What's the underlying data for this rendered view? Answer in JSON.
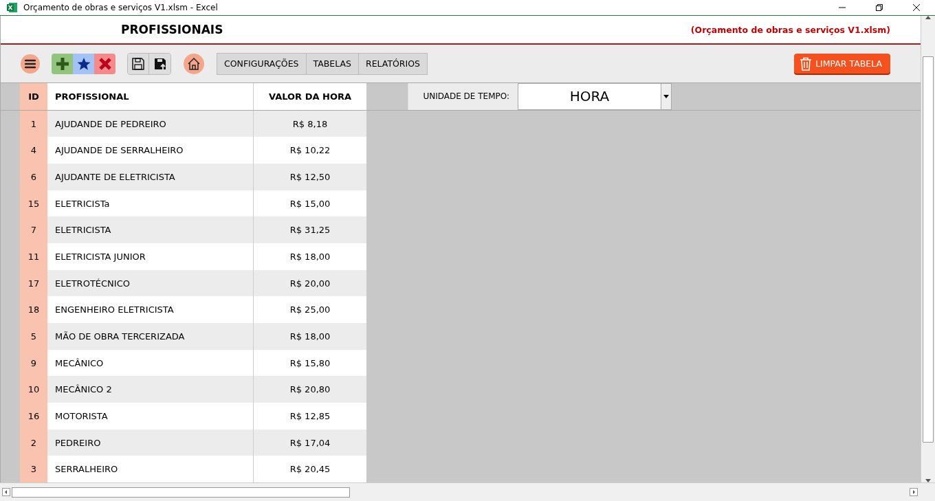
{
  "window": {
    "title": "Orçamento de obras e serviços V1.xlsm - Excel"
  },
  "header": {
    "title": "PROFISSIONAIS",
    "file": "(Orçamento de obras e serviços V1.xlsm)"
  },
  "menus": [
    {
      "label": "CONFIGURAÇÕES"
    },
    {
      "label": "TABELAS"
    },
    {
      "label": "RELATÓRIOS"
    }
  ],
  "clear_button": {
    "label": "LIMPAR TABELA"
  },
  "table": {
    "columns": [
      "ID",
      "PROFISSIONAL",
      "VALOR DA HORA"
    ],
    "rows": [
      [
        "1",
        "AJUDANDE DE PEDREIRO",
        "R$ 8,18"
      ],
      [
        "4",
        "AJUDANDE DE SERRALHEIRO",
        "R$ 10,22"
      ],
      [
        "6",
        "AJUDANTE DE ELETRICISTA",
        "R$ 12,50"
      ],
      [
        "15",
        "ELETRICISTa",
        "R$ 15,00"
      ],
      [
        "7",
        "ELETRICISTA",
        "R$ 31,25"
      ],
      [
        "11",
        "ELETRICISTA JUNIOR",
        "R$ 18,00"
      ],
      [
        "17",
        "ELETROTÉCNICO",
        "R$ 20,00"
      ],
      [
        "18",
        "ENGENHEIRO ELETRICISTA",
        "R$ 25,00"
      ],
      [
        "5",
        "MÃO DE OBRA TERCERIZADA",
        "R$ 18,00"
      ],
      [
        "9",
        "MECÂNICO",
        "R$ 15,80"
      ],
      [
        "10",
        "MECÂNICO 2",
        "R$ 20,80"
      ],
      [
        "16",
        "MOTORISTA",
        "R$ 12,85"
      ],
      [
        "2",
        "PEDREIRO",
        "R$ 17,04"
      ],
      [
        "3",
        "SERRALHEIRO",
        "R$ 20,45"
      ]
    ]
  },
  "time_unit": {
    "label": "UNIDADE DE TEMPO:",
    "value": "HORA"
  }
}
